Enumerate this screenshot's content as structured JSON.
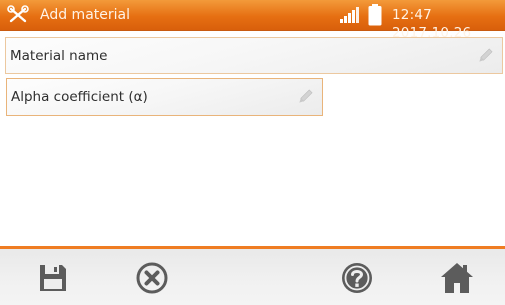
{
  "header": {
    "title": "Add material",
    "clock": "12:47 2017.10.26",
    "icons": {
      "menu": "tools-icon",
      "signal": "signal-icon",
      "battery": "battery-icon"
    }
  },
  "form": {
    "material_name_placeholder": "Material name",
    "alpha_coefficient_placeholder": "Alpha coefficient (α)",
    "edit_icon": "pencil-icon"
  },
  "toolbar": {
    "icons": [
      "save-icon",
      "cancel-icon",
      "help-icon",
      "home-icon"
    ]
  },
  "colors": {
    "accent": "#e66f12",
    "field_border": "#ecc89f",
    "icon_gray": "#5c5c5c"
  }
}
